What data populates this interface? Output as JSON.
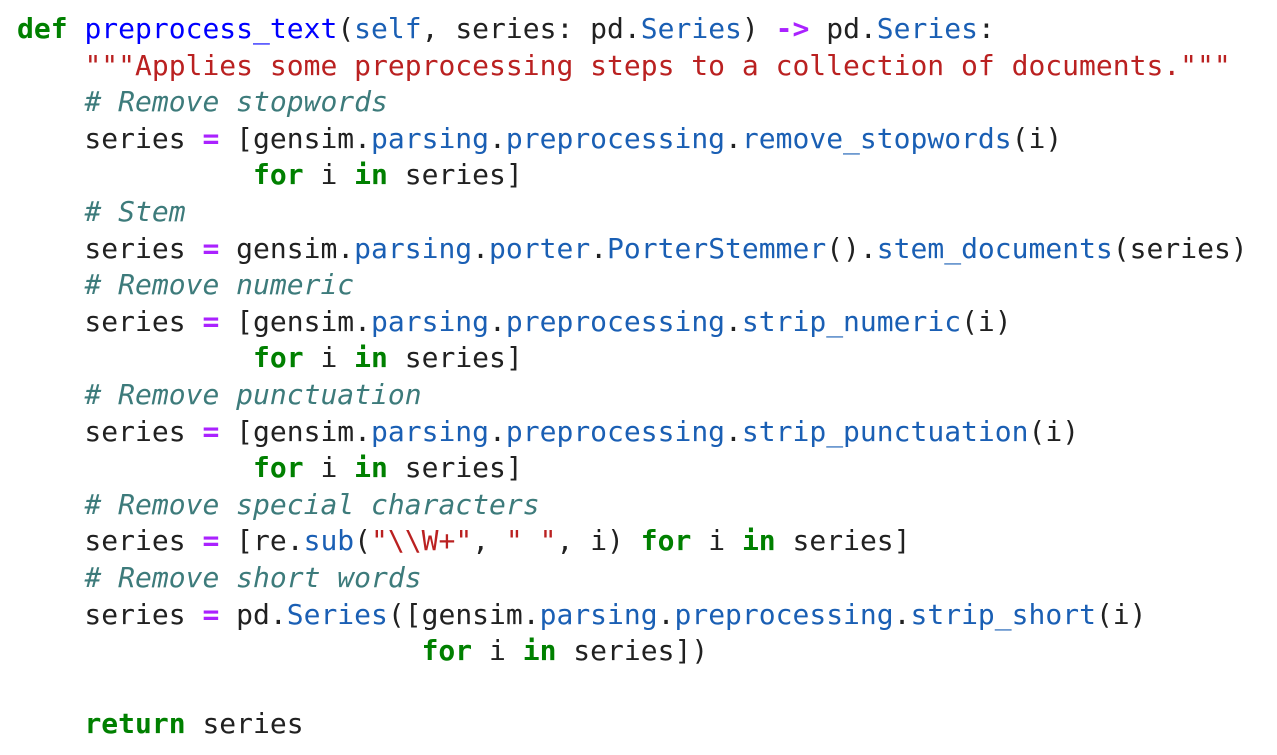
{
  "colors": {
    "keyword": "#008000",
    "function_name": "#0000ff",
    "operator": "#aa22ff",
    "attribute": "#1a5fb4",
    "string": "#ba2121",
    "comment": "#3d7b7b",
    "text": "#212121",
    "background": "#ffffff"
  },
  "code_lines": [
    [
      {
        "t": "def",
        "c": "kw"
      },
      {
        "t": " ",
        "c": "tx"
      },
      {
        "t": "preprocess_text",
        "c": "fn"
      },
      {
        "t": "(",
        "c": "tx"
      },
      {
        "t": "self",
        "c": "attr"
      },
      {
        "t": ", series: pd.",
        "c": "tx"
      },
      {
        "t": "Series",
        "c": "attr"
      },
      {
        "t": ") ",
        "c": "tx"
      },
      {
        "t": "->",
        "c": "op"
      },
      {
        "t": " pd.",
        "c": "tx"
      },
      {
        "t": "Series",
        "c": "attr"
      },
      {
        "t": ":",
        "c": "tx"
      }
    ],
    [
      {
        "t": "    ",
        "c": "tx"
      },
      {
        "t": "\"\"\"Applies some preprocessing steps to a collection of documents.\"\"\"",
        "c": "str"
      }
    ],
    [
      {
        "t": "    ",
        "c": "tx"
      },
      {
        "t": "# Remove stopwords",
        "c": "cm"
      }
    ],
    [
      {
        "t": "    series ",
        "c": "tx"
      },
      {
        "t": "=",
        "c": "op"
      },
      {
        "t": " [gensim.",
        "c": "tx"
      },
      {
        "t": "parsing",
        "c": "attr"
      },
      {
        "t": ".",
        "c": "tx"
      },
      {
        "t": "preprocessing",
        "c": "attr"
      },
      {
        "t": ".",
        "c": "tx"
      },
      {
        "t": "remove_stopwords",
        "c": "attr"
      },
      {
        "t": "(i)",
        "c": "tx"
      }
    ],
    [
      {
        "t": "              ",
        "c": "tx"
      },
      {
        "t": "for",
        "c": "kw"
      },
      {
        "t": " i ",
        "c": "tx"
      },
      {
        "t": "in",
        "c": "kw"
      },
      {
        "t": " series]",
        "c": "tx"
      }
    ],
    [
      {
        "t": "    ",
        "c": "tx"
      },
      {
        "t": "# Stem",
        "c": "cm"
      }
    ],
    [
      {
        "t": "    series ",
        "c": "tx"
      },
      {
        "t": "=",
        "c": "op"
      },
      {
        "t": " gensim.",
        "c": "tx"
      },
      {
        "t": "parsing",
        "c": "attr"
      },
      {
        "t": ".",
        "c": "tx"
      },
      {
        "t": "porter",
        "c": "attr"
      },
      {
        "t": ".",
        "c": "tx"
      },
      {
        "t": "PorterStemmer",
        "c": "attr"
      },
      {
        "t": "().",
        "c": "tx"
      },
      {
        "t": "stem_documents",
        "c": "attr"
      },
      {
        "t": "(series)",
        "c": "tx"
      }
    ],
    [
      {
        "t": "    ",
        "c": "tx"
      },
      {
        "t": "# Remove numeric",
        "c": "cm"
      }
    ],
    [
      {
        "t": "    series ",
        "c": "tx"
      },
      {
        "t": "=",
        "c": "op"
      },
      {
        "t": " [gensim.",
        "c": "tx"
      },
      {
        "t": "parsing",
        "c": "attr"
      },
      {
        "t": ".",
        "c": "tx"
      },
      {
        "t": "preprocessing",
        "c": "attr"
      },
      {
        "t": ".",
        "c": "tx"
      },
      {
        "t": "strip_numeric",
        "c": "attr"
      },
      {
        "t": "(i)",
        "c": "tx"
      }
    ],
    [
      {
        "t": "              ",
        "c": "tx"
      },
      {
        "t": "for",
        "c": "kw"
      },
      {
        "t": " i ",
        "c": "tx"
      },
      {
        "t": "in",
        "c": "kw"
      },
      {
        "t": " series]",
        "c": "tx"
      }
    ],
    [
      {
        "t": "    ",
        "c": "tx"
      },
      {
        "t": "# Remove punctuation",
        "c": "cm"
      }
    ],
    [
      {
        "t": "    series ",
        "c": "tx"
      },
      {
        "t": "=",
        "c": "op"
      },
      {
        "t": " [gensim.",
        "c": "tx"
      },
      {
        "t": "parsing",
        "c": "attr"
      },
      {
        "t": ".",
        "c": "tx"
      },
      {
        "t": "preprocessing",
        "c": "attr"
      },
      {
        "t": ".",
        "c": "tx"
      },
      {
        "t": "strip_punctuation",
        "c": "attr"
      },
      {
        "t": "(i)",
        "c": "tx"
      }
    ],
    [
      {
        "t": "              ",
        "c": "tx"
      },
      {
        "t": "for",
        "c": "kw"
      },
      {
        "t": " i ",
        "c": "tx"
      },
      {
        "t": "in",
        "c": "kw"
      },
      {
        "t": " series]",
        "c": "tx"
      }
    ],
    [
      {
        "t": "    ",
        "c": "tx"
      },
      {
        "t": "# Remove special characters",
        "c": "cm"
      }
    ],
    [
      {
        "t": "    series ",
        "c": "tx"
      },
      {
        "t": "=",
        "c": "op"
      },
      {
        "t": " [re.",
        "c": "tx"
      },
      {
        "t": "sub",
        "c": "attr"
      },
      {
        "t": "(",
        "c": "tx"
      },
      {
        "t": "\"\\\\W+\"",
        "c": "str"
      },
      {
        "t": ", ",
        "c": "tx"
      },
      {
        "t": "\" \"",
        "c": "str"
      },
      {
        "t": ", i) ",
        "c": "tx"
      },
      {
        "t": "for",
        "c": "kw"
      },
      {
        "t": " i ",
        "c": "tx"
      },
      {
        "t": "in",
        "c": "kw"
      },
      {
        "t": " series]",
        "c": "tx"
      }
    ],
    [
      {
        "t": "    ",
        "c": "tx"
      },
      {
        "t": "# Remove short words",
        "c": "cm"
      }
    ],
    [
      {
        "t": "    series ",
        "c": "tx"
      },
      {
        "t": "=",
        "c": "op"
      },
      {
        "t": " pd.",
        "c": "tx"
      },
      {
        "t": "Series",
        "c": "attr"
      },
      {
        "t": "([gensim.",
        "c": "tx"
      },
      {
        "t": "parsing",
        "c": "attr"
      },
      {
        "t": ".",
        "c": "tx"
      },
      {
        "t": "preprocessing",
        "c": "attr"
      },
      {
        "t": ".",
        "c": "tx"
      },
      {
        "t": "strip_short",
        "c": "attr"
      },
      {
        "t": "(i)",
        "c": "tx"
      }
    ],
    [
      {
        "t": "                        ",
        "c": "tx"
      },
      {
        "t": "for",
        "c": "kw"
      },
      {
        "t": " i ",
        "c": "tx"
      },
      {
        "t": "in",
        "c": "kw"
      },
      {
        "t": " series])",
        "c": "tx"
      }
    ],
    [],
    [
      {
        "t": "    ",
        "c": "tx"
      },
      {
        "t": "return",
        "c": "kw"
      },
      {
        "t": " series",
        "c": "tx"
      }
    ]
  ]
}
